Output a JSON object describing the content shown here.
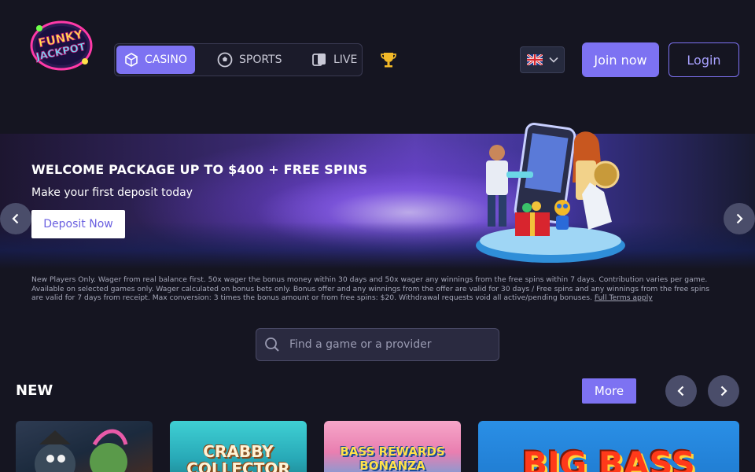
{
  "header": {
    "logo_text_line1": "FUNKY",
    "logo_text_line2": "JACKPOT",
    "nav": [
      {
        "label": "CASINO",
        "icon": "dice-icon",
        "active": true
      },
      {
        "label": "SPORTS",
        "icon": "soccer-ball-icon",
        "active": false
      },
      {
        "label": "LIVE",
        "icon": "live-cards-icon",
        "active": false
      }
    ],
    "trophy_icon": "trophy-icon",
    "language_flag": "uk-flag-icon",
    "join_label": "Join now",
    "login_label": "Login"
  },
  "banner": {
    "title": "WELCOME PACKAGE UP TO $400 + FREE SPINS",
    "subtitle": "Make your first deposit today",
    "cta_label": "Deposit Now"
  },
  "terms": {
    "text": "New Players Only. Wager from real balance first. 50x wager the bonus money within 30 days and 50x wager any winnings from the free spins within 7 days. Contribution varies per game. Available on selected games only. Wager calculated on bonus bets only. Bonus offer and any winnings from the offer are valid for 30 days / Free spins and any winnings from the free spins are valid for 7 days from receipt. Max conversion: 3 times the bonus amount or from free spins: $20. Withdrawal requests void all active/pending bonuses.",
    "link_label": "Full Terms apply"
  },
  "search": {
    "placeholder": "Find a game or a provider"
  },
  "new_section": {
    "title": "NEW",
    "more_label": "More",
    "games": [
      {
        "title": ""
      },
      {
        "title": "CRABBY COLLECTOR"
      },
      {
        "title": "BASS REWARDS BONANZA"
      },
      {
        "title": "BIG BASS"
      }
    ]
  },
  "colors": {
    "accent": "#7d72f2",
    "background": "#151521"
  }
}
